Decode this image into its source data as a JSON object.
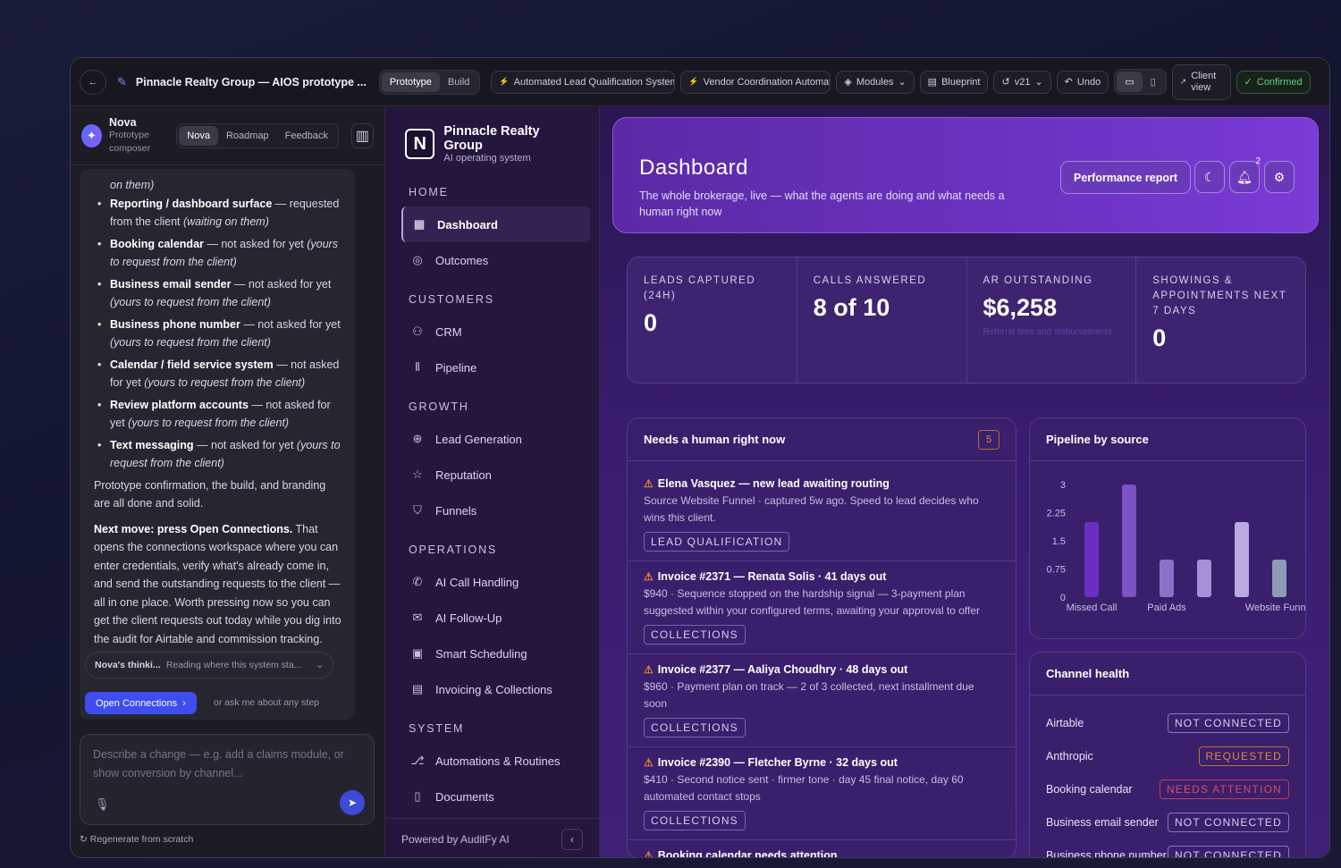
{
  "topbar": {
    "title": "Pinnacle Realty Group — AIOS prototype ...",
    "modes": [
      "Prototype",
      "Build"
    ],
    "active_mode": "Prototype",
    "chip1": "Automated Lead Qualification System",
    "chip2": "Vendor Coordination Automat",
    "modules": "Modules",
    "blueprint": "Blueprint",
    "version": "v21",
    "undo": "Undo",
    "client_view": "Client view",
    "confirmed": "Confirmed"
  },
  "nova": {
    "name": "Nova",
    "subtitle": "Prototype composer",
    "tabs": [
      "Nova",
      "Roadmap",
      "Feedback"
    ],
    "chat_top_fragment": "on them)",
    "bullets": [
      {
        "bold": "Reporting / dashboard surface",
        "text": " — requested from the client ",
        "ital": "(waiting on them)"
      },
      {
        "bold": "Booking calendar",
        "text": " — not asked for yet ",
        "ital": "(yours to request from the client)"
      },
      {
        "bold": "Business email sender",
        "text": " — not asked for yet ",
        "ital": "(yours to request from the client)"
      },
      {
        "bold": "Business phone number",
        "text": " — not asked for yet ",
        "ital": "(yours to request from the client)"
      },
      {
        "bold": "Calendar / field service system",
        "text": " — not asked for yet ",
        "ital": "(yours to request from the client)"
      },
      {
        "bold": "Review platform accounts",
        "text": " — not asked for yet ",
        "ital": "(yours to request from the client)"
      },
      {
        "bold": "Text messaging",
        "text": " — not asked for yet ",
        "ital": "(yours to request from the client)"
      }
    ],
    "para1": "Prototype confirmation, the build, and branding are all done and solid.",
    "para2_bold": "Next move: press Open Connections.",
    "para2": " That opens the connections workspace where you can enter credentials, verify what's already come in, and send the outstanding requests to the client — all in one place. Worth pressing now so you can get the client requests out today while you dig into the audit for Airtable and commission tracking.",
    "thinking_label": "Nova's thinki...",
    "thinking_text": "Reading where this system sta...",
    "open_button": "Open Connections",
    "ask": "or ask me about any step",
    "composer_placeholder": "Describe a change — e.g. add a claims module, or show conversion by channel...",
    "regenerate": "Regenerate from scratch"
  },
  "sidebar": {
    "brand": "Pinnacle Realty Group",
    "brand_sub": "AI operating system",
    "sections": [
      {
        "title": "HOME",
        "items": [
          {
            "label": "Dashboard",
            "icon": "grid-icon",
            "active": true
          },
          {
            "label": "Outcomes",
            "icon": "target-icon"
          }
        ]
      },
      {
        "title": "CUSTOMERS",
        "items": [
          {
            "label": "CRM",
            "icon": "users-icon"
          },
          {
            "label": "Pipeline",
            "icon": "columns-icon"
          }
        ]
      },
      {
        "title": "GROWTH",
        "items": [
          {
            "label": "Lead Generation",
            "icon": "magnet-icon"
          },
          {
            "label": "Reputation",
            "icon": "star-icon"
          },
          {
            "label": "Funnels",
            "icon": "filter-icon"
          }
        ]
      },
      {
        "title": "OPERATIONS",
        "items": [
          {
            "label": "AI Call Handling",
            "icon": "phone-icon"
          },
          {
            "label": "AI Follow-Up",
            "icon": "mail-icon"
          },
          {
            "label": "Smart Scheduling",
            "icon": "calendar-icon"
          },
          {
            "label": "Invoicing & Collections",
            "icon": "invoice-icon"
          }
        ]
      },
      {
        "title": "SYSTEM",
        "items": [
          {
            "label": "Automations & Routines",
            "icon": "workflow-icon"
          },
          {
            "label": "Documents",
            "icon": "document-icon"
          }
        ]
      }
    ],
    "footer": "Powered by AuditFy AI"
  },
  "dashboard": {
    "title": "Dashboard",
    "subtitle": "The whole brokerage, live — what the agents are doing and what needs a human right now",
    "performance": "Performance report",
    "notifications": "2",
    "stats": [
      {
        "label": "LEADS CAPTURED (24H)",
        "value": "0"
      },
      {
        "label": "CALLS ANSWERED",
        "value": "8 of 10"
      },
      {
        "label": "AR OUTSTANDING",
        "value": "$6,258",
        "note": "Referral fees and disbursements"
      },
      {
        "label": "SHOWINGS & APPOINTMENTS NEXT 7 DAYS",
        "value": "0"
      }
    ],
    "needs": {
      "title": "Needs a human right now",
      "count": "5",
      "items": [
        {
          "title": "Elena Vasquez — new lead awaiting routing",
          "desc": "Source Website Funnel · captured 5w ago. Speed to lead decides who wins this client.",
          "tag": "LEAD QUALIFICATION"
        },
        {
          "title": "Invoice #2371 — Renata Solis · 41 days out",
          "desc": "$940 · Sequence stopped on the hardship signal — 3-payment plan suggested within your configured terms, awaiting your approval to offer",
          "tag": "COLLECTIONS"
        },
        {
          "title": "Invoice #2377 — Aaliya Choudhry · 48 days out",
          "desc": "$960 · Payment plan on track — 2 of 3 collected, next installment due soon",
          "tag": "COLLECTIONS"
        },
        {
          "title": "Invoice #2390 — Fletcher Byrne · 32 days out",
          "desc": "$410 · Second notice sent · firmer tone · day 45 final notice, day 60 automated contact stops",
          "tag": "COLLECTIONS"
        },
        {
          "title": "Booking calendar needs attention",
          "desc": "",
          "tag": ""
        }
      ]
    },
    "channels": {
      "title": "Channel health",
      "rows": [
        {
          "name": "Airtable",
          "status": "NOT CONNECTED",
          "kind": "nc"
        },
        {
          "name": "Anthropic",
          "status": "REQUESTED",
          "kind": "req"
        },
        {
          "name": "Booking calendar",
          "status": "NEEDS ATTENTION",
          "kind": "att"
        },
        {
          "name": "Business email sender",
          "status": "NOT CONNECTED",
          "kind": "nc"
        },
        {
          "name": "Business phone number",
          "status": "NOT CONNECTED",
          "kind": "nc"
        }
      ]
    }
  },
  "chart_data": {
    "type": "bar",
    "title": "Pipeline by source",
    "categories": [
      "Missed Call",
      "",
      "Paid Ads",
      "",
      "",
      "Website Funnel"
    ],
    "values": [
      2,
      3,
      1,
      1,
      2,
      1
    ],
    "colors": [
      "#6a2fc0",
      "#7c52c4",
      "#8a72c6",
      "#a690d6",
      "#b9aadf",
      "#8f9ab6"
    ],
    "ylim": [
      0,
      3
    ],
    "yticks": [
      "0",
      "0.75",
      "1.5",
      "2.25",
      "3"
    ]
  }
}
